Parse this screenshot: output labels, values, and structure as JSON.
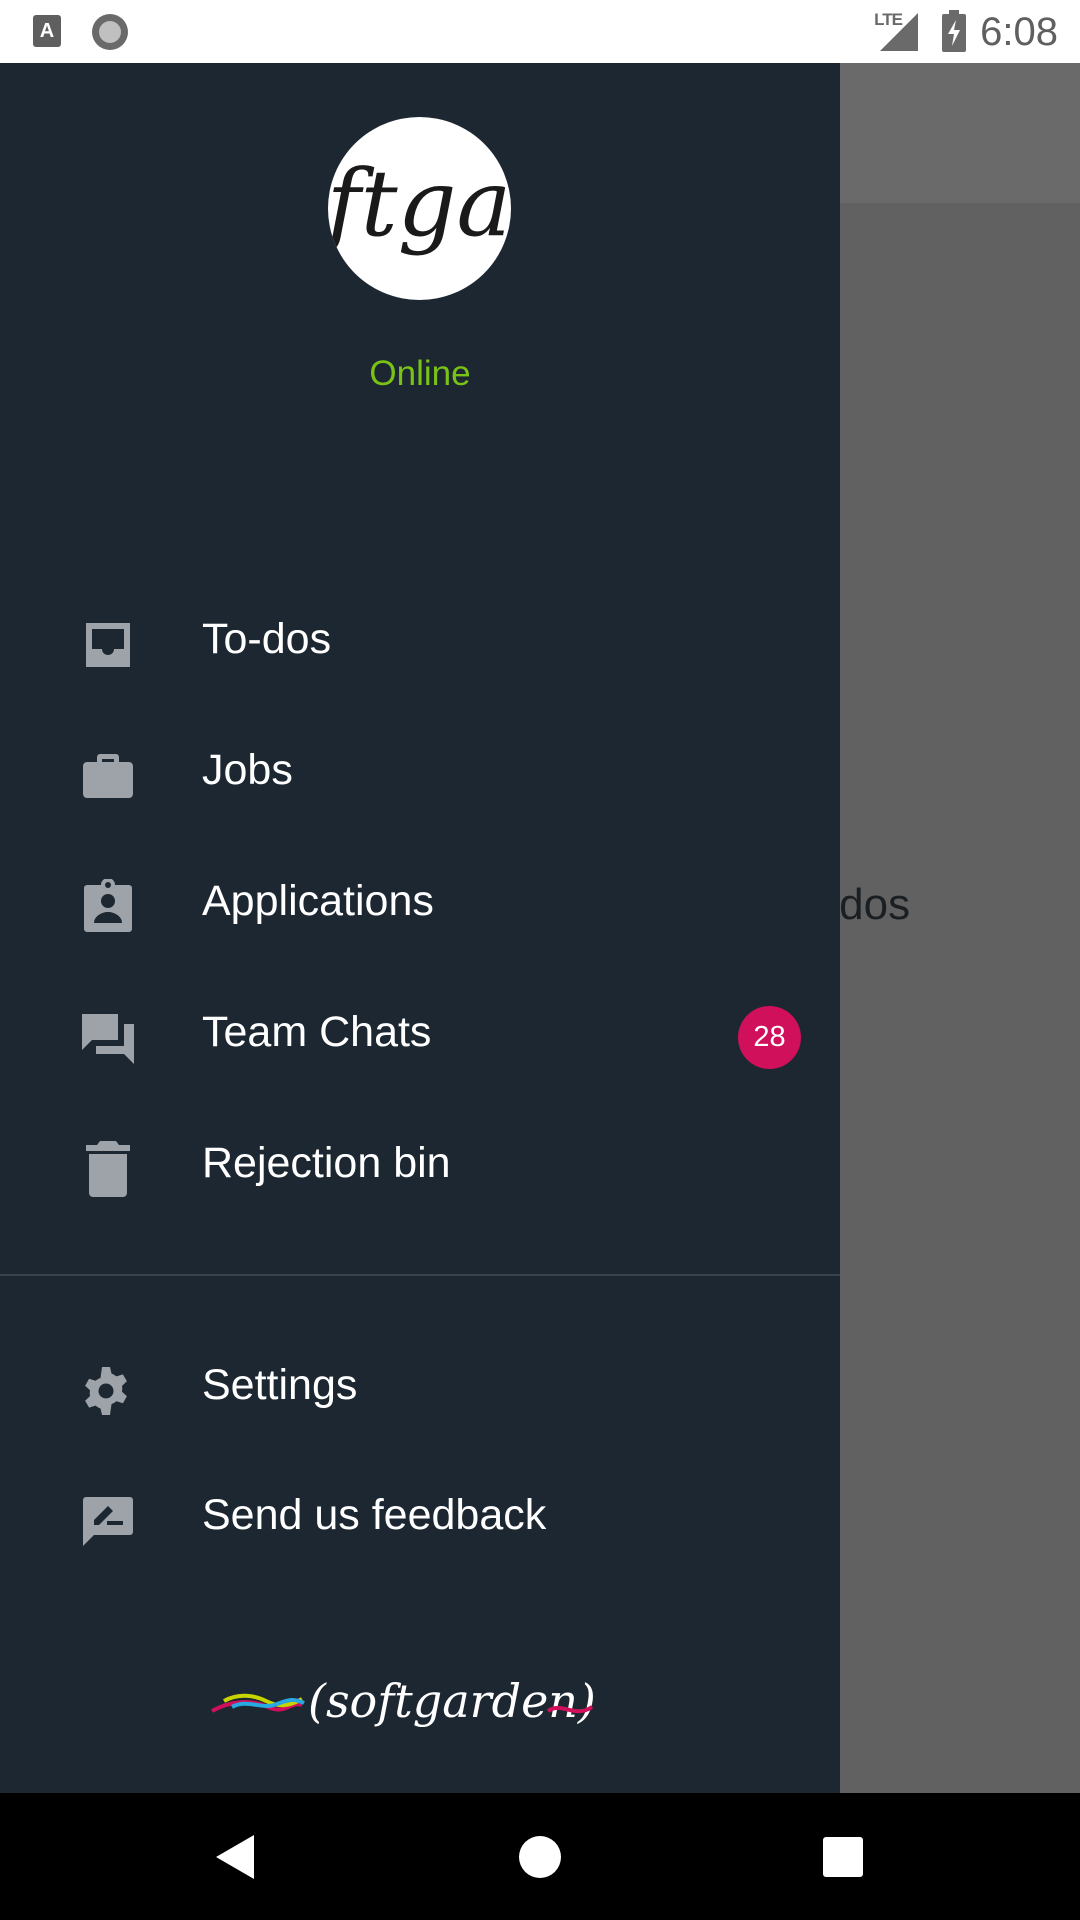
{
  "status_bar": {
    "time": "6:08",
    "network": "LTE",
    "left_icons": [
      "text-a-icon",
      "circle-record-icon"
    ],
    "right_icons": [
      "signal-icon",
      "battery-charging-icon"
    ]
  },
  "profile": {
    "avatar_text": "ftga",
    "status": "Online",
    "status_color": "#7ac316"
  },
  "menu": {
    "items": [
      {
        "id": "todos",
        "label": "To-dos",
        "icon": "inbox-icon"
      },
      {
        "id": "jobs",
        "label": "Jobs",
        "icon": "briefcase-icon"
      },
      {
        "id": "applications",
        "label": "Applications",
        "icon": "contact-card-icon"
      },
      {
        "id": "team-chats",
        "label": "Team Chats",
        "icon": "chat-bubbles-icon",
        "badge": "28"
      },
      {
        "id": "rejection-bin",
        "label": "Rejection bin",
        "icon": "trash-icon"
      }
    ],
    "secondary": [
      {
        "id": "settings",
        "label": "Settings",
        "icon": "gear-icon"
      },
      {
        "id": "feedback",
        "label": "Send us feedback",
        "icon": "feedback-icon"
      }
    ]
  },
  "branding": {
    "logo_text": "(softgarden)"
  },
  "background": {
    "partial_text": "To-dos"
  },
  "colors": {
    "drawer_bg": "#1c2731",
    "badge": "#d0105a",
    "scrim": "#606060"
  }
}
